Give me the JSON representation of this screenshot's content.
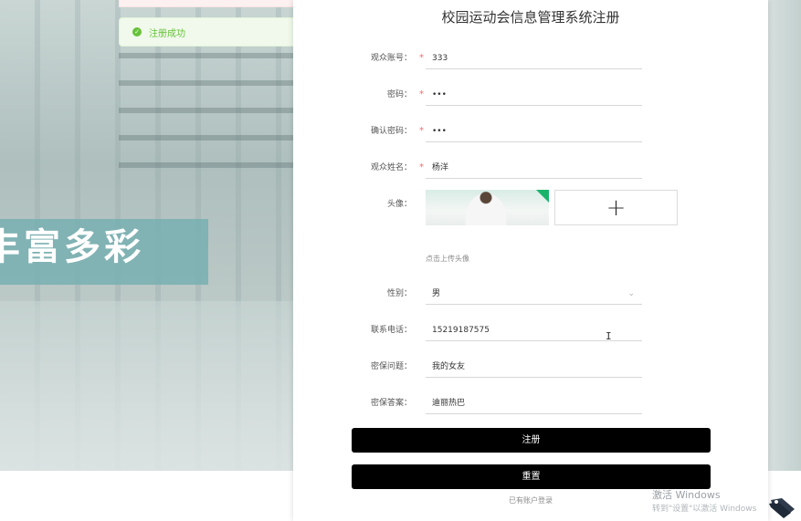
{
  "background": {
    "slogan": "丰富多彩"
  },
  "toast": {
    "message": "注册成功",
    "color": "#67c23a"
  },
  "form": {
    "title": "校园运动会信息管理系统注册",
    "fields": [
      {
        "label": "观众账号：",
        "value": "333",
        "required": true
      },
      {
        "label": "密码：",
        "value": "•••",
        "required": true
      },
      {
        "label": "确认密码：",
        "value": "•••",
        "required": true
      },
      {
        "label": "观众姓名：",
        "value": "杨洋",
        "required": true
      }
    ],
    "avatar": {
      "label": "头像：",
      "upload_hint": "点击上传头像",
      "plus_icon": "+"
    },
    "gender": {
      "label": "性别：",
      "value": "男",
      "icon": "chevron-down-icon"
    },
    "phone": {
      "label": "联系电话：",
      "value": "15219187575"
    },
    "security_question": {
      "label": "密保问题：",
      "value": "我的女友"
    },
    "security_answer": {
      "label": "密保答案：",
      "value": "迪丽热巴"
    },
    "register_label": "注册",
    "reset_label": "重置",
    "login_link": "已有账户登录"
  },
  "watermark": {
    "line1": "激活 Windows",
    "line2": "转到\"设置\"以激活 Windows"
  },
  "colors": {
    "button": "#000000",
    "required": "#f56c6c",
    "success": "#67c23a"
  }
}
